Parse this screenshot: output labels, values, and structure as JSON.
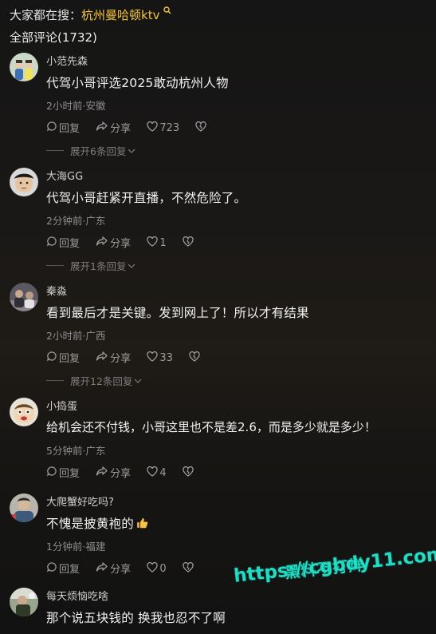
{
  "header": {
    "search_prefix": "大家都在搜：",
    "search_keyword": "杭州曼哈顿ktv",
    "comment_count": "全部评论(1732)"
  },
  "labels": {
    "reply": "回复",
    "share": "分享"
  },
  "comments": [
    {
      "username": "小范先森",
      "text": "代驾小哥评选2025敢动杭州人物",
      "meta": "2小时前·安徽",
      "likes": "723",
      "expand": "展开6条回复"
    },
    {
      "username": "大海GG",
      "text": "代驾小哥赶紧开直播，不然危险了。",
      "meta": "2分钟前·广东",
      "likes": "1",
      "expand": "展开1条回复"
    },
    {
      "username": "秦淼",
      "text": "看到最后才是关键。发到网上了！所以才有结果",
      "meta": "2小时前·广西",
      "likes": "33",
      "expand": "展开12条回复"
    },
    {
      "username": "小捣蛋",
      "text": "给机会还不付钱，小哥这里也不是差2.6，而是多少就是多少！",
      "meta": "5分钟前·广东",
      "likes": "4",
      "expand": ""
    },
    {
      "username": "大爬蟹好吃吗?",
      "text": "不愧是披黄袍的",
      "meta": "1分钟前·福建",
      "likes": "0",
      "expand": ""
    },
    {
      "username": "每天烦恼吃啥",
      "text": "那个说五块钱的 换我也忍不了啊",
      "meta": "",
      "likes": "",
      "expand": ""
    }
  ],
  "watermark": {
    "line1": "黑料不打烊",
    "line2": "https://cgbdy11.com"
  },
  "colors": {
    "keyword": "#f4c43a",
    "watermark": "#22dcc4"
  }
}
